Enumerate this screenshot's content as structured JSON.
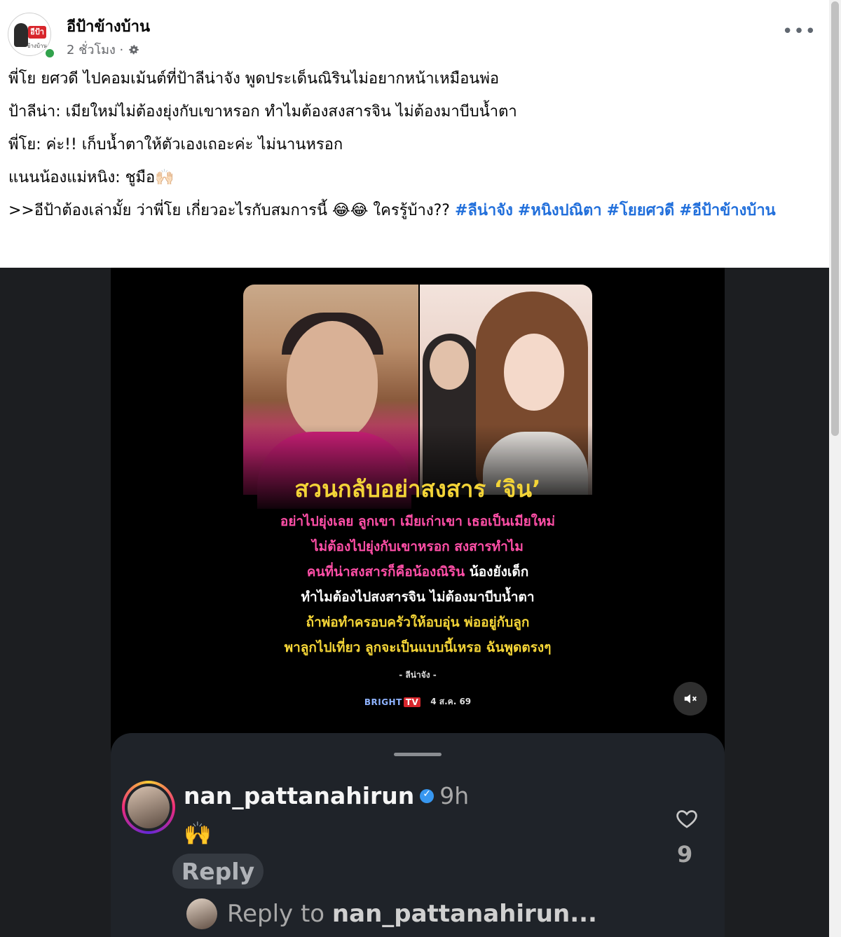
{
  "post": {
    "page_name": "อีป้าข้างบ้าน",
    "time": "2 ชั่วโมง ·",
    "avatar_text": "อีป้า",
    "avatar_sub": "ข้างบ้าน",
    "more_label": "•••",
    "paragraphs": [
      "พี่โย ยศวดี ไปคอมเม้นต์ที่ป้าลีน่าจัง พูดประเด็นณิรินไม่อยากหน้าเหมือนพ่อ",
      "ป้าลีน่า: เมียใหม่ไม่ต้องยุ่งกับเขาหรอก ทำไมต้องสงสารจิน ไม่ต้องมาบีบน้ำตา",
      "พี่โย: ค่ะ!! เก็บน้ำตาให้ตัวเองเถอะค่ะ ไม่นานหรอก",
      "แนนน้องแม่หนิง: ชูมือ🙌🏻"
    ],
    "last_paragraph": ">>อีป้าต้องเล่ามั้ย ว่าพี่โย เกี่ยวอะไรกับสมการนี้ 😂😂 ใครรู้บ้าง?? ",
    "hashtags": [
      "#ลีน่าจัง",
      "#หนิงปณิตา",
      "#โยยศวดี",
      "#อีป้าข้างบ้าน"
    ]
  },
  "card": {
    "headline": "สวนกลับอย่าสงสาร ‘จิน’",
    "lines": [
      {
        "text": "อย่าไปยุ่งเลย ลูกเขา เมียเก่าเขา เธอเป็นเมียใหม่",
        "color": "pink"
      },
      {
        "text": "ไม่ต้องไปยุ่งกับเขาหรอก สงสารทำไม",
        "color": "pink"
      },
      {
        "text": "คนที่น่าสงสารก็คือน้องณิริน",
        "color": "pink",
        "tail": " น้องยังเด็ก"
      },
      {
        "text": "ทำไมต้องไปสงสารจิน ไม่ต้องมาบีบน้ำตา",
        "color": "white"
      },
      {
        "text": "ถ้าพ่อทำครอบครัวให้อบอุ่น พ่ออยู่กับลูก",
        "color": "yellow"
      },
      {
        "text": "พาลูกไปเที่ยว ลูกจะเป็นแบบนี้เหรอ ฉันพูดตรงๆ",
        "color": "yellow"
      }
    ],
    "source": "- ลีน่าจัง -",
    "brand": "BRIGHT",
    "brand_tv": "TV",
    "date": "4 ส.ค. 69"
  },
  "comment": {
    "username": "nan_pattanahirun",
    "time": "9h",
    "text": "🙌",
    "reply_label": "Reply",
    "likes": "9",
    "reply_prompt": "Reply to ",
    "reply_target": "nan_pattanahirun..."
  },
  "colors": {
    "hashtag": "#216fdb",
    "headline": "#f3d437",
    "pink": "#ff4fa7",
    "verified": "#3797f0"
  }
}
